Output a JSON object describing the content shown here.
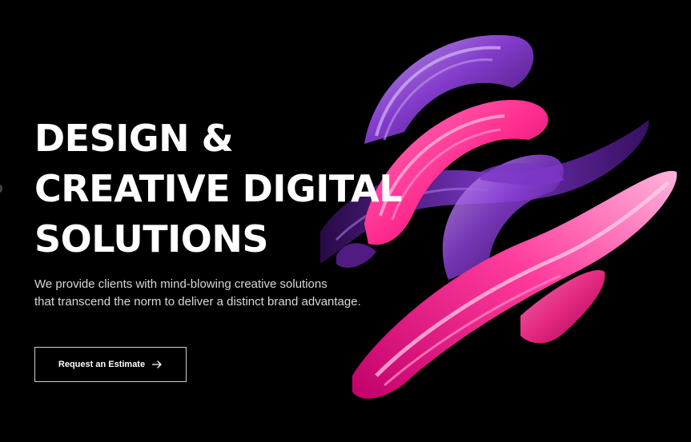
{
  "hero": {
    "headline": [
      "DESIGN &",
      "CREATIVE DIGITAL",
      "SOLUTIONS"
    ],
    "subtitle": [
      "We provide clients with mind-blowing creative solutions",
      "that transcend the norm to deliver a distinct brand advantage."
    ],
    "cta_label": "Request an Estimate",
    "cta_icon": "arrow-right-icon"
  },
  "colors": {
    "background": "#000000",
    "text": "#ffffff",
    "subtitle": "#d8d8d8",
    "border": "#cfcfcf",
    "brush_magenta": "#ff2d8f",
    "brush_purple": "#8a3fd6",
    "brush_violet": "#5a1f8f"
  }
}
